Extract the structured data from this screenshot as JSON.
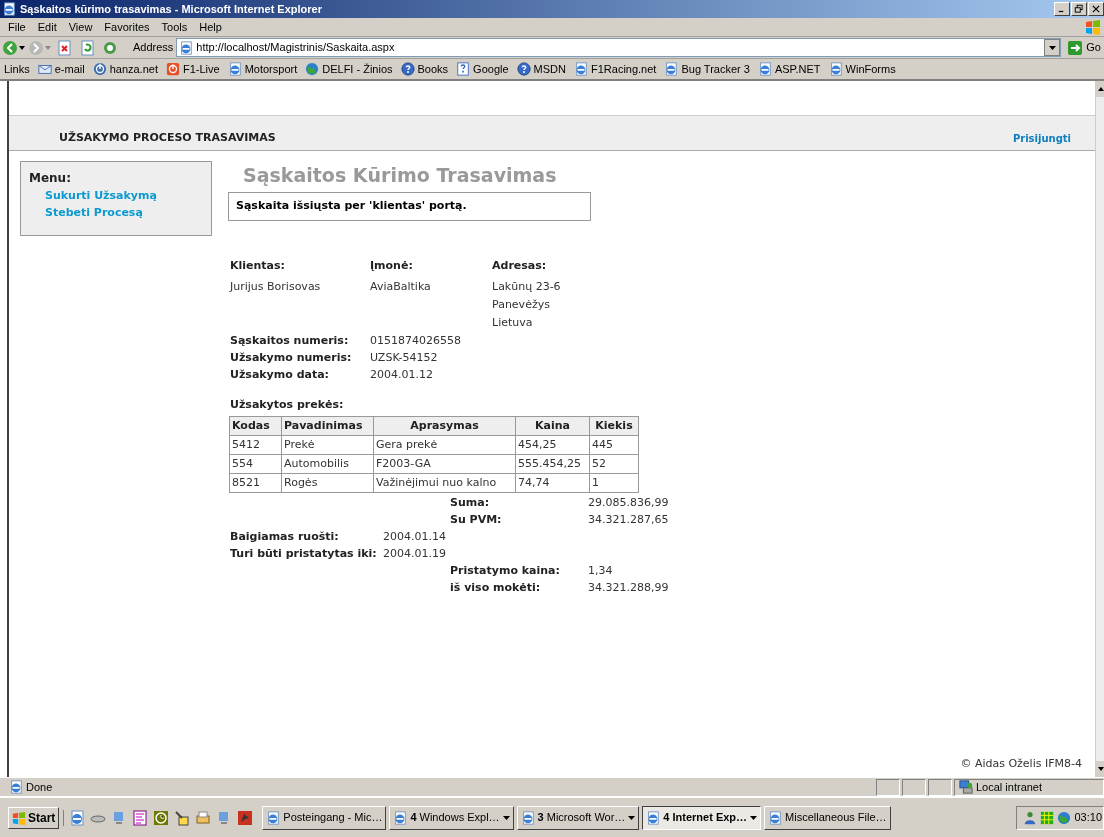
{
  "window": {
    "title": "Sąskaitos kūrimo trasavimas - Microsoft Internet Explorer"
  },
  "menu_bar": [
    "File",
    "Edit",
    "View",
    "Favorites",
    "Tools",
    "Help"
  ],
  "address": {
    "label": "Address",
    "url": "http://localhost/Magistrinis/Saskaita.aspx",
    "go": "Go"
  },
  "links": {
    "label": "Links",
    "items": [
      {
        "label": "e-mail",
        "kind": "mail"
      },
      {
        "label": "hanza.net",
        "kind": "power"
      },
      {
        "label": "F1-Live",
        "kind": "f1"
      },
      {
        "label": "Motorsport",
        "kind": "ie"
      },
      {
        "label": "DELFI - Žinios",
        "kind": "globe"
      },
      {
        "label": "Books",
        "kind": "help"
      },
      {
        "label": "Google",
        "kind": "doc"
      },
      {
        "label": "MSDN",
        "kind": "help"
      },
      {
        "label": "F1Racing.net",
        "kind": "ie"
      },
      {
        "label": "Bug Tracker 3",
        "kind": "ie"
      },
      {
        "label": "ASP.NET",
        "kind": "ie"
      },
      {
        "label": "WinForms",
        "kind": "ie"
      }
    ]
  },
  "page": {
    "site_title": "UŽSAKYMO PROCESO TRASAVIMAS",
    "login_link": "Prisijungti",
    "menu": {
      "title": "Menu:",
      "items": [
        "Sukurti Užsakymą",
        "Stebeti Procesą"
      ]
    },
    "heading": "Sąskaitos Kūrimo Trasavimas",
    "message": "Sąskaita išsiųsta per 'klientas' portą.",
    "parties": [
      {
        "label": "Klientas:",
        "lines": [
          "Jurijus Borisovas"
        ]
      },
      {
        "label": "Įmonė:",
        "lines": [
          "AviaBaltika"
        ]
      },
      {
        "label": "Adresas:",
        "lines": [
          "Lakūnų 23-6",
          "Panevėžys",
          "Lietuva"
        ]
      }
    ],
    "details": [
      {
        "label": "Sąskaitos numeris:",
        "value": "0151874026558"
      },
      {
        "label": "Užsakymo numeris:",
        "value": "UZSK-54152"
      },
      {
        "label": "Užsakymo data:",
        "value": "2004.01.12"
      }
    ],
    "items_title": "Užsakytos prekės:",
    "table": {
      "columns": [
        "Kodas",
        "Pavadinimas",
        "Aprasymas",
        "Kaina",
        "Kiekis"
      ],
      "rows": [
        [
          "5412",
          "Prekė",
          "Gera prekė",
          "454,25",
          "445"
        ],
        [
          "554",
          "Automobilis",
          "F2003-GA",
          "555.454,25",
          "52"
        ],
        [
          "8521",
          "Rogės",
          "Važinėjimui nuo kalno",
          "74,74",
          "1"
        ]
      ]
    },
    "sums": [
      {
        "label": "Suma:",
        "value": "29.085.836,99"
      },
      {
        "label": "Su PVM:",
        "value": "34.321.287,65"
      }
    ],
    "dates": [
      {
        "label": "Baigiamas ruošti:",
        "value": "2004.01.14"
      },
      {
        "label": "Turi būti pristatytas iki:",
        "value": "2004.01.19"
      }
    ],
    "delivery": [
      {
        "label": "Pristatymo kaina:",
        "value": "1,34"
      },
      {
        "label": "iš viso mokėti:",
        "value": "34.321.288,99"
      }
    ],
    "footer": "© Aidas Oželis IFM8-4"
  },
  "status_bar": {
    "text": "Done",
    "zone": "Local intranet"
  },
  "taskbar": {
    "start": "Start",
    "tasks": [
      {
        "label": "Posteingang - Mic…",
        "selected": false,
        "grouped": false
      },
      {
        "count": "4",
        "label": "Windows Expl…",
        "selected": false,
        "grouped": true
      },
      {
        "count": "3",
        "label": "Microsoft Wor…",
        "selected": false,
        "grouped": true
      },
      {
        "count": "4",
        "label": "Internet Exp…",
        "selected": true,
        "grouped": true
      },
      {
        "label": "Miscellaneous File…",
        "selected": false,
        "grouped": false
      }
    ],
    "clock": "03:10"
  }
}
